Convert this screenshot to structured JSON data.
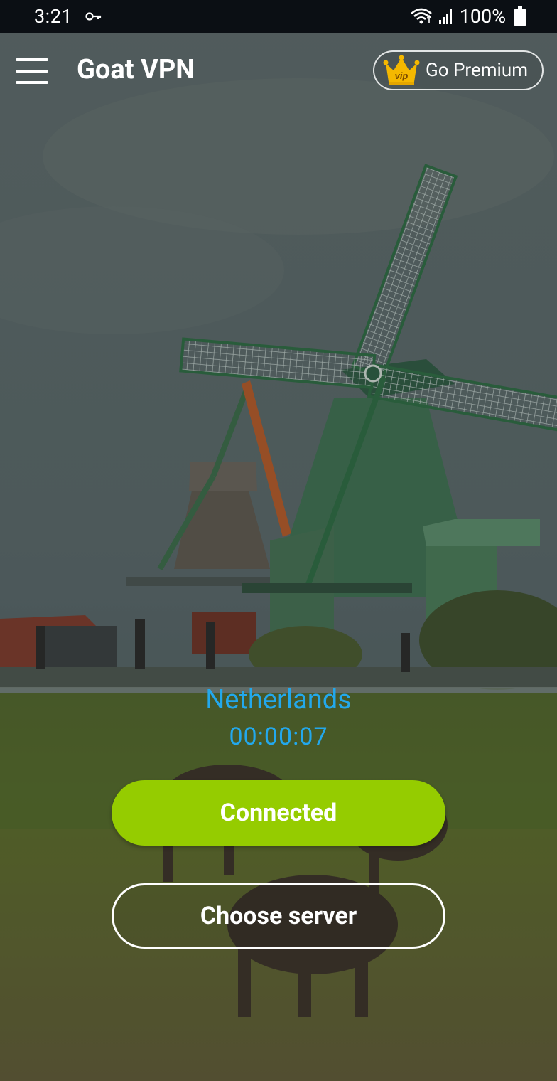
{
  "status_bar": {
    "time": "3:21",
    "battery": "100%",
    "icons": [
      "vpn-key-icon",
      "wifi-icon",
      "signal-icon",
      "battery-icon"
    ]
  },
  "app_bar": {
    "title": "Goat VPN",
    "premium_label": "Go Premium",
    "premium_badge": "vip"
  },
  "connection": {
    "country": "Netherlands",
    "elapsed": "00:00:07",
    "status_button": "Connected",
    "choose_server_button": "Choose server"
  },
  "colors": {
    "accent_blue": "#23a8ec",
    "connected_green": "#95cc00",
    "crown_gold": "#f5b800",
    "status_bar_bg": "#0b0f14"
  }
}
